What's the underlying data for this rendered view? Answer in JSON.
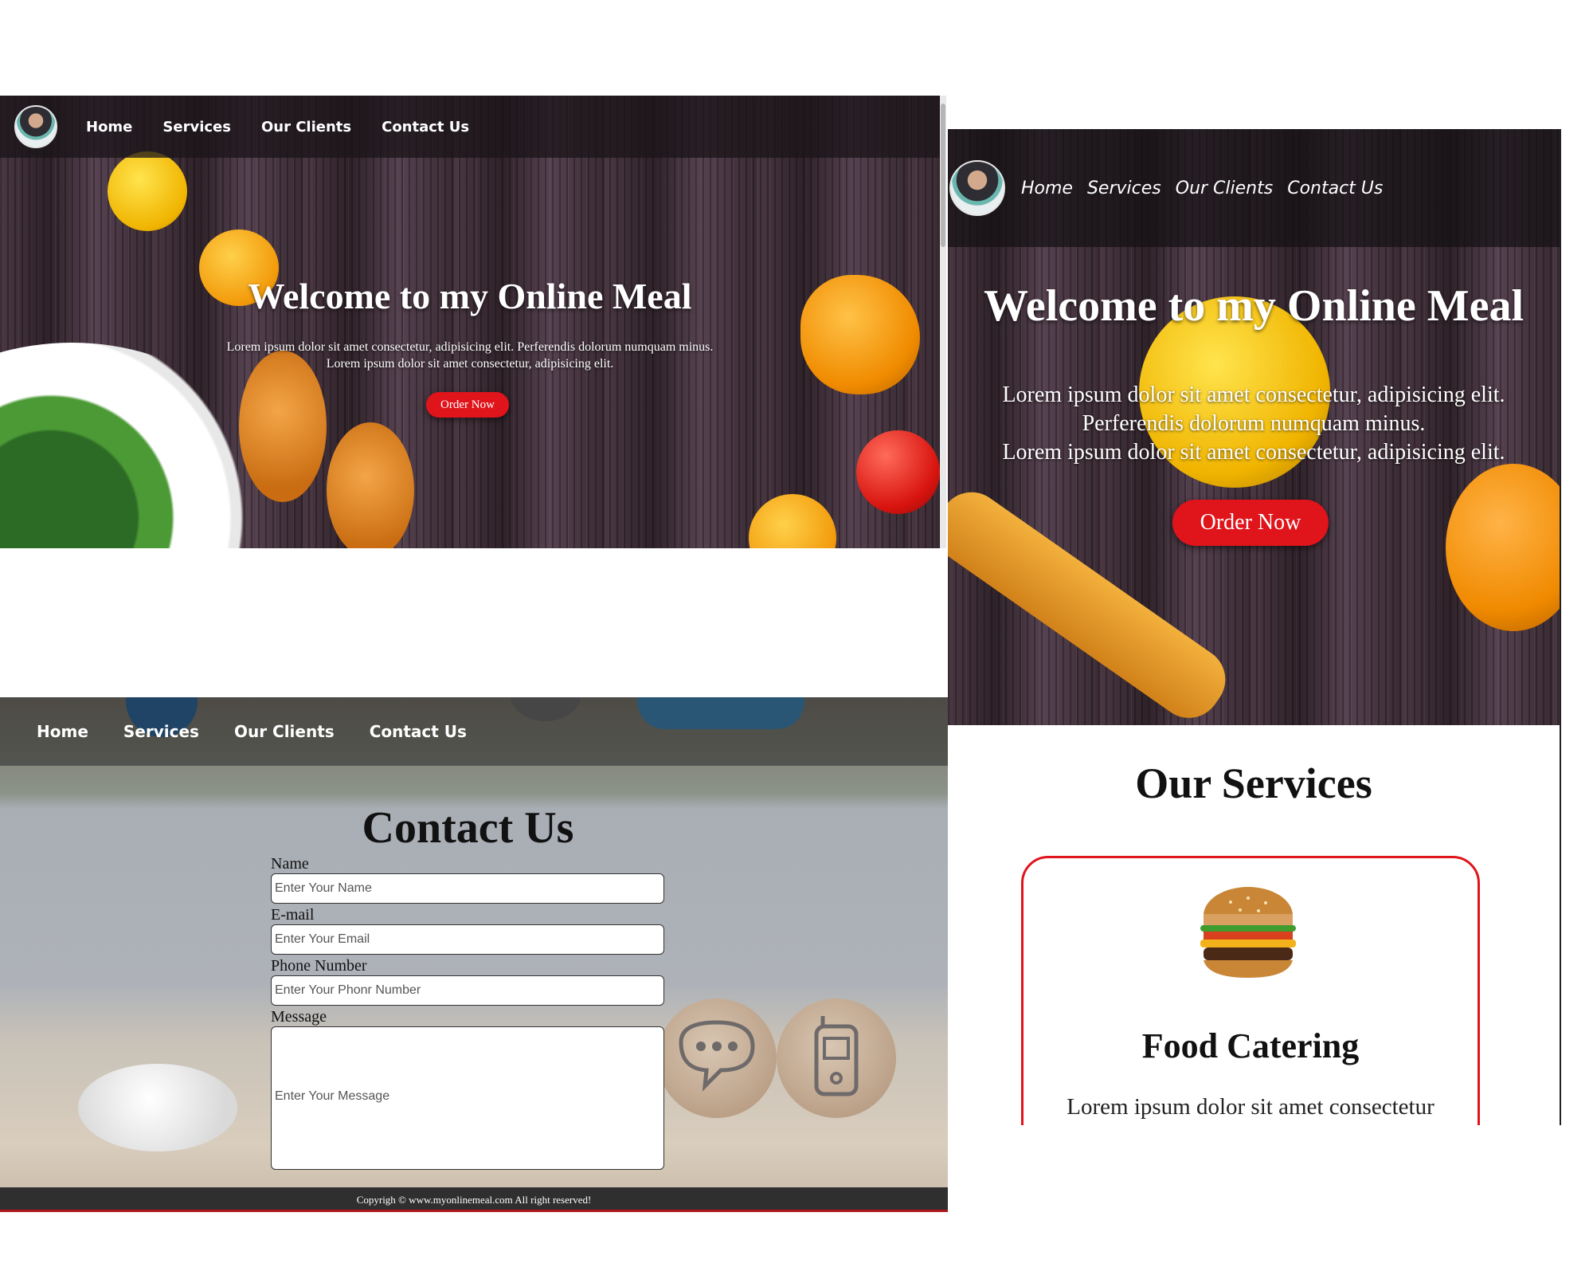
{
  "brand_colors": {
    "accent": "#e0141b",
    "footer": "#2f2f2f"
  },
  "nav": {
    "home": "Home",
    "services": "Services",
    "clients": "Our Clients",
    "contact": "Contact Us"
  },
  "hero": {
    "title": "Welcome to my Online Meal",
    "line1_desktop": "Lorem ipsum dolor sit amet consectetur, adipisicing elit. Perferendis dolorum numquam minus.",
    "line2_desktop": "Lorem ipsum dolor sit amet consectetur, adipisicing elit.",
    "line1_mobile": "Lorem ipsum dolor sit amet consectetur, adipisicing elit.",
    "line2_mobile": "Perferendis dolorum numquam minus.",
    "line3_mobile": "Lorem ipsum dolor sit amet consectetur, adipisicing elit.",
    "button": "Order Now"
  },
  "services": {
    "title": "Our Services",
    "card_title": "Food Catering",
    "card_text": "Lorem ipsum dolor sit amet consectetur"
  },
  "contact": {
    "title": "Contact Us",
    "name_label": "Name",
    "name_placeholder": "Enter Your Name",
    "email_label": "E-mail",
    "email_placeholder": "Enter Your Email",
    "phone_label": "Phone Number",
    "phone_placeholder": "Enter Your Phonr Number",
    "message_label": "Message",
    "message_placeholder": "Enter Your Message"
  },
  "footer": {
    "text": "Copyrigh © www.myonlinemeal.com All right reserved!"
  },
  "icons": [
    "avatar-icon",
    "burger-icon",
    "chat-bubble-icon",
    "mobile-phone-icon"
  ]
}
